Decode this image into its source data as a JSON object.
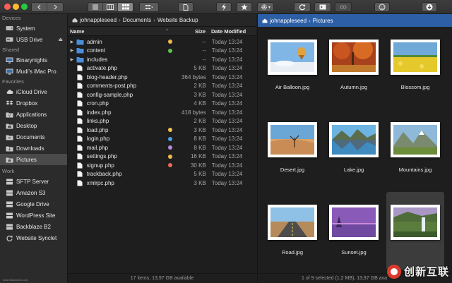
{
  "toolbar": {
    "back_icon": "chevron-left-icon",
    "forward_icon": "chevron-right-icon",
    "view_modes": [
      "list-view-icon",
      "column-view-icon",
      "grid-view-icon"
    ],
    "grid_view_icon": "grid-view-icon",
    "doc_icon": "document-icon",
    "flash_icon": "lightning-icon",
    "star_icon": "star-icon",
    "gear_icon": "gear-icon",
    "gear_dropdown": "▾",
    "sync_icon": "sync-icon",
    "terminal_icon": "terminal-icon",
    "link_icon": "link-icon",
    "smiley_icon": "smiley-icon",
    "download_icon": "download-icon"
  },
  "sidebar": {
    "sections": [
      {
        "title": "Devices",
        "items": [
          {
            "label": "System",
            "icon": "hard-drive-icon"
          },
          {
            "label": "USB Drive",
            "icon": "usb-drive-icon",
            "eject": "⏏"
          }
        ]
      },
      {
        "title": "Shared",
        "items": [
          {
            "label": "Binarynights",
            "icon": "monitor-icon"
          },
          {
            "label": "Mudi's iMac Pro",
            "icon": "monitor-icon"
          }
        ]
      },
      {
        "title": "Favorites",
        "items": [
          {
            "label": "iCloud Drive",
            "icon": "cloud-icon"
          },
          {
            "label": "Dropbox",
            "icon": "dropbox-icon"
          },
          {
            "label": "Applications",
            "icon": "applications-icon"
          },
          {
            "label": "Desktop",
            "icon": "desktop-icon"
          },
          {
            "label": "Documents",
            "icon": "documents-icon"
          },
          {
            "label": "Downloads",
            "icon": "downloads-icon"
          },
          {
            "label": "Pictures",
            "icon": "pictures-icon",
            "selected": true
          }
        ]
      },
      {
        "title": "Work",
        "items": [
          {
            "label": "SFTP Server",
            "icon": "server-icon"
          },
          {
            "label": "Amazon S3",
            "icon": "server-icon"
          },
          {
            "label": "Google Drive",
            "icon": "server-icon"
          },
          {
            "label": "WordPress Site",
            "icon": "server-icon"
          },
          {
            "label": "Backblaze B2",
            "icon": "server-icon"
          },
          {
            "label": "Website Synclet",
            "icon": "sync-icon"
          }
        ]
      }
    ],
    "footer": "www.MacDown.com"
  },
  "left_pane": {
    "path": [
      "johnappleseed",
      "Documents",
      "Website Backup"
    ],
    "path_sep": "›",
    "columns": {
      "name": "Name",
      "sort_chevron": "^",
      "size": "Size",
      "date": "Date Modified"
    },
    "files": [
      {
        "name": "admin",
        "type": "folder",
        "expand": "▶",
        "size": "--",
        "date": "Today 13:24",
        "tag": "#f0b94a"
      },
      {
        "name": "content",
        "type": "folder",
        "expand": "▶",
        "size": "--",
        "date": "Today 13:24",
        "tag": "#5fc24b"
      },
      {
        "name": "includes",
        "type": "folder",
        "expand": "▶",
        "size": "--",
        "date": "Today 13:24",
        "tag": ""
      },
      {
        "name": "activate.php",
        "type": "file",
        "expand": "",
        "size": "5 KB",
        "date": "Today 13:24",
        "tag": ""
      },
      {
        "name": "blog-header.php",
        "type": "file",
        "expand": "",
        "size": "364 bytes",
        "date": "Today 13:24",
        "tag": ""
      },
      {
        "name": "comments-post.php",
        "type": "file",
        "expand": "",
        "size": "2 KB",
        "date": "Today 13:24",
        "tag": ""
      },
      {
        "name": "config-sample.php",
        "type": "file",
        "expand": "",
        "size": "3 KB",
        "date": "Today 13:24",
        "tag": ""
      },
      {
        "name": "cron.php",
        "type": "file",
        "expand": "",
        "size": "4 KB",
        "date": "Today 13:24",
        "tag": ""
      },
      {
        "name": "index.php",
        "type": "file",
        "expand": "",
        "size": "418 bytes",
        "date": "Today 13:24",
        "tag": ""
      },
      {
        "name": "links.php",
        "type": "file",
        "expand": "",
        "size": "2 KB",
        "date": "Today 13:24",
        "tag": ""
      },
      {
        "name": "load.php",
        "type": "file",
        "expand": "",
        "size": "3 KB",
        "date": "Today 13:24",
        "tag": "#f0c04e"
      },
      {
        "name": "login.php",
        "type": "file",
        "expand": "",
        "size": "8 KB",
        "date": "Today 13:24",
        "tag": "#4aa0e6"
      },
      {
        "name": "mail.php",
        "type": "file",
        "expand": "",
        "size": "8 KB",
        "date": "Today 13:24",
        "tag": "#b48ae0"
      },
      {
        "name": "settings.php",
        "type": "file",
        "expand": "",
        "size": "16 KB",
        "date": "Today 13:24",
        "tag": "#f0b94a"
      },
      {
        "name": "signup.php",
        "type": "file",
        "expand": "",
        "size": "30 KB",
        "date": "Today 13:24",
        "tag": "#ec6a5a"
      },
      {
        "name": "trackback.php",
        "type": "file",
        "expand": "",
        "size": "5 KB",
        "date": "Today 13:24",
        "tag": ""
      },
      {
        "name": "xmlrpc.php",
        "type": "file",
        "expand": "",
        "size": "3 KB",
        "date": "Today 13:24",
        "tag": ""
      }
    ],
    "status": "17 items, 13,97 GB available"
  },
  "right_pane": {
    "path": [
      "johnappleseed",
      "Pictures"
    ],
    "path_sep": "›",
    "pictures": [
      {
        "name": "Air Balloon.jpg",
        "scene": "balloon"
      },
      {
        "name": "Autumn.jpg",
        "scene": "autumn"
      },
      {
        "name": "Blossom.jpg",
        "scene": "blossom"
      },
      {
        "name": "Desert.jpg",
        "scene": "desert"
      },
      {
        "name": "Lake.jpg",
        "scene": "lake"
      },
      {
        "name": "Mountains.jpg",
        "scene": "mountains"
      },
      {
        "name": "Road.jpg",
        "scene": "road"
      },
      {
        "name": "Sunset.jpg",
        "scene": "sunset"
      },
      {
        "name": "",
        "scene": "waterfall",
        "selected": true
      }
    ],
    "status": "1 of 9 selected (1,2 MB), 13,97 GB ava"
  },
  "watermark": {
    "text": "创新互联"
  },
  "colors": {
    "accent_path": "#2d5fa6",
    "folder": "#4a90d9"
  }
}
